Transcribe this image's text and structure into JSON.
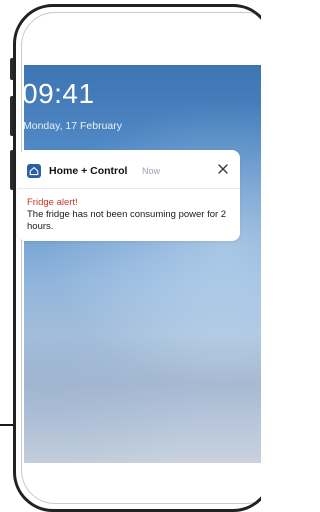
{
  "lock_screen": {
    "time": "09:41",
    "date": "Monday, 17 February"
  },
  "notification": {
    "app_name": "Home + Control",
    "time_label": "Now",
    "title": "Fridge alert!",
    "body": "The fridge has not been consuming power for 2 hours.",
    "app_icon": "home-icon",
    "close_icon": "close-icon"
  },
  "colors": {
    "alert_title": "#d0342c",
    "app_icon_bg": "#2a5fa8",
    "wallpaper_top": "#3d74b3",
    "wallpaper_bottom": "#c9d2dd"
  }
}
